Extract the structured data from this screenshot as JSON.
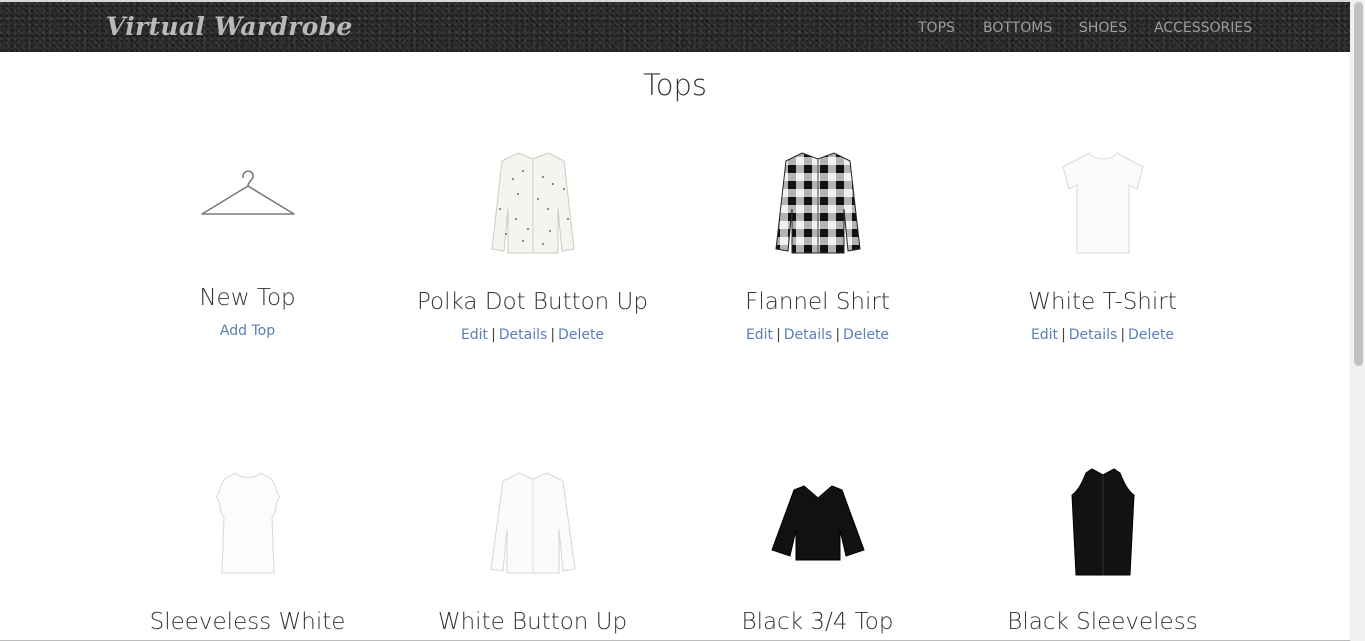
{
  "navbar": {
    "brand": "Virtual Wardrobe",
    "items": [
      "TOPS",
      "BOTTOMS",
      "SHOES",
      "ACCESSORIES"
    ]
  },
  "page": {
    "title": "Tops"
  },
  "new_card": {
    "name": "New Top",
    "link": "Add Top",
    "icon": "hanger-icon"
  },
  "cards": [
    {
      "name": "Polka Dot Button Up",
      "edit": "Edit",
      "details": "Details",
      "delete": "Delete",
      "sep": "|",
      "icon": "polka-dot-shirt-icon"
    },
    {
      "name": "Flannel Shirt",
      "edit": "Edit",
      "details": "Details",
      "delete": "Delete",
      "sep": "|",
      "icon": "flannel-shirt-icon"
    },
    {
      "name": "White T-Shirt",
      "edit": "Edit",
      "details": "Details",
      "delete": "Delete",
      "sep": "|",
      "icon": "white-tshirt-icon"
    },
    {
      "name": "Sleeveless White",
      "icon": "ruffle-top-icon"
    },
    {
      "name": "White Button Up",
      "icon": "white-button-up-icon"
    },
    {
      "name": "Black 3/4 Top",
      "icon": "black-bell-sleeve-top-icon"
    },
    {
      "name": "Black Sleeveless",
      "icon": "black-sleeveless-top-icon"
    }
  ],
  "colors": {
    "link": "#5a7fb5",
    "navbar": "#2a2a2a",
    "nav_text": "#9d9d9d",
    "brand": "#b9b9b9"
  }
}
